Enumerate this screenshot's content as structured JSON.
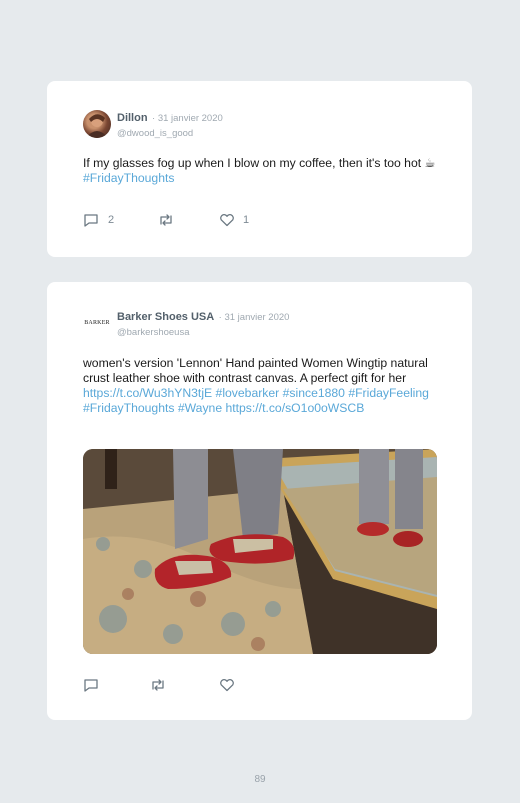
{
  "tweets": [
    {
      "display_name": "Dillon",
      "date": "· 31 janvier 2020",
      "handle": "@dwood_is_good",
      "text_plain": "If my glasses fog up when I blow on my coffee, then it's too hot ☕ ",
      "text_link": "#FridayThoughts",
      "replies": "2",
      "likes": "1",
      "icons": [
        "reply-icon",
        "retweet-icon",
        "heart-icon"
      ]
    },
    {
      "display_name": "Barker Shoes USA",
      "date": "· 31 janvier 2020",
      "handle": "@barkershoeusa",
      "avatar_text": "BARKER",
      "text_plain": "women's version 'Lennon' Hand painted Women Wingtip natural crust leather shoe with contrast canvas. A perfect gift for her ",
      "text_link": "https://t.co/Wu3hYN3tjE #lovebarker #since1880 #FridayFeeling #FridayThoughts #Wayne https://t.co/sO1o0oWSCB",
      "icons": [
        "reply-icon",
        "retweet-icon",
        "heart-icon"
      ]
    }
  ],
  "page_number": "89",
  "colors": {
    "link": "#5aa8d8",
    "background": "#e6eaed",
    "card": "#ffffff"
  }
}
